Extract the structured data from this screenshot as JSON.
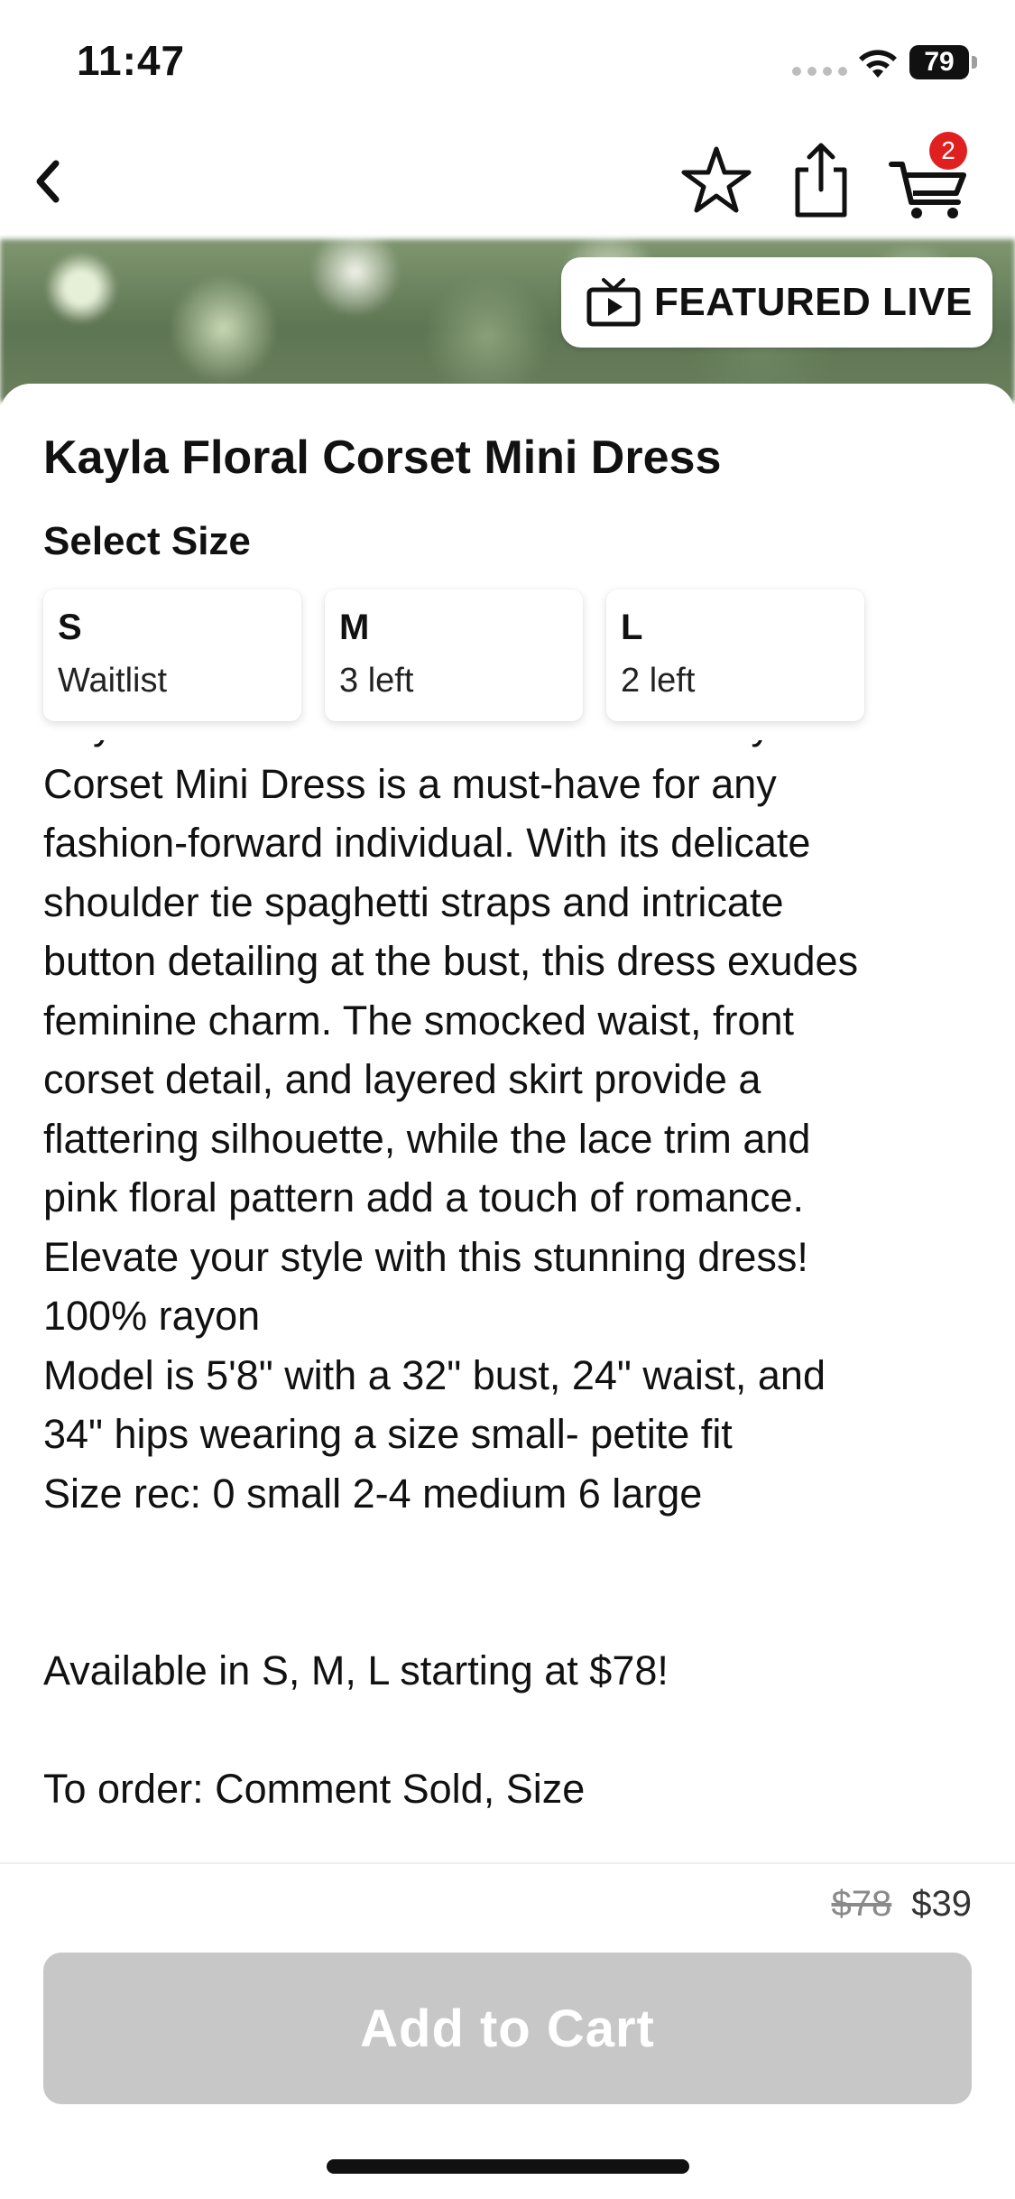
{
  "status_bar": {
    "time": "11:47",
    "battery": "79"
  },
  "nav": {
    "icons": [
      "back-chevron-icon",
      "star-icon",
      "share-icon",
      "cart-icon"
    ],
    "cart_badge_count": "2"
  },
  "hero": {
    "featured_live_label": "FEATURED LIVE",
    "icon": "tv-play-icon"
  },
  "product": {
    "title": "Kayla Floral Corset Mini Dress",
    "select_size_label": "Select Size",
    "sizes": [
      {
        "name": "S",
        "stock": "Waitlist"
      },
      {
        "name": "M",
        "stock": "3 left"
      },
      {
        "name": "L",
        "stock": "2 left"
      }
    ],
    "description": "Kayla Floral Corset Mini Dress: This Kayla Floral\nCorset Mini Dress is a must-have for any\nfashion-forward individual. With its delicate\nshoulder tie spaghetti straps and intricate\nbutton detailing at the bust, this dress exudes\nfeminine charm. The smocked waist, front\ncorset detail, and layered skirt provide a\nflattering silhouette, while the lace trim and\npink floral pattern add a touch of romance.\nElevate your style with this stunning dress!\n100% rayon\nModel is 5'8\" with a 32\" bust, 24\" waist, and\n34\" hips wearing a size small- petite fit\nSize rec: 0 small 2-4 medium 6 large\n\n\nAvailable in S, M, L starting at $78!\n\nTo order: Comment Sold, Size"
  },
  "pricing": {
    "original_price": "$78",
    "sale_price": "$39",
    "add_to_cart_label": "Add to Cart"
  },
  "colors": {
    "badge_red": "#e02020",
    "button_disabled": "#c7c7c7"
  }
}
